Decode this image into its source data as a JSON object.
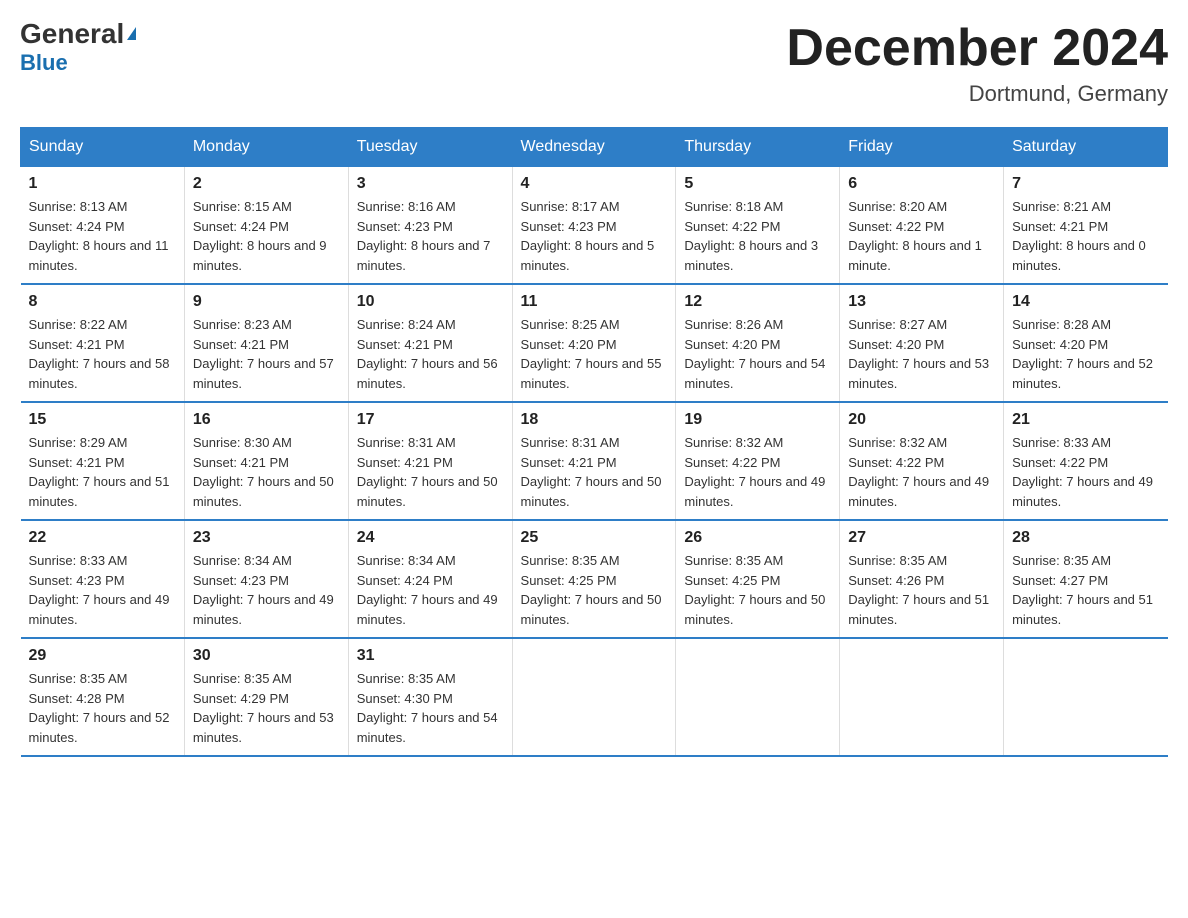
{
  "logo": {
    "part1": "General",
    "part2": "Blue"
  },
  "title": "December 2024",
  "location": "Dortmund, Germany",
  "days_header": [
    "Sunday",
    "Monday",
    "Tuesday",
    "Wednesday",
    "Thursday",
    "Friday",
    "Saturday"
  ],
  "weeks": [
    [
      {
        "num": "1",
        "sunrise": "8:13 AM",
        "sunset": "4:24 PM",
        "daylight": "8 hours and 11 minutes."
      },
      {
        "num": "2",
        "sunrise": "8:15 AM",
        "sunset": "4:24 PM",
        "daylight": "8 hours and 9 minutes."
      },
      {
        "num": "3",
        "sunrise": "8:16 AM",
        "sunset": "4:23 PM",
        "daylight": "8 hours and 7 minutes."
      },
      {
        "num": "4",
        "sunrise": "8:17 AM",
        "sunset": "4:23 PM",
        "daylight": "8 hours and 5 minutes."
      },
      {
        "num": "5",
        "sunrise": "8:18 AM",
        "sunset": "4:22 PM",
        "daylight": "8 hours and 3 minutes."
      },
      {
        "num": "6",
        "sunrise": "8:20 AM",
        "sunset": "4:22 PM",
        "daylight": "8 hours and 1 minute."
      },
      {
        "num": "7",
        "sunrise": "8:21 AM",
        "sunset": "4:21 PM",
        "daylight": "8 hours and 0 minutes."
      }
    ],
    [
      {
        "num": "8",
        "sunrise": "8:22 AM",
        "sunset": "4:21 PM",
        "daylight": "7 hours and 58 minutes."
      },
      {
        "num": "9",
        "sunrise": "8:23 AM",
        "sunset": "4:21 PM",
        "daylight": "7 hours and 57 minutes."
      },
      {
        "num": "10",
        "sunrise": "8:24 AM",
        "sunset": "4:21 PM",
        "daylight": "7 hours and 56 minutes."
      },
      {
        "num": "11",
        "sunrise": "8:25 AM",
        "sunset": "4:20 PM",
        "daylight": "7 hours and 55 minutes."
      },
      {
        "num": "12",
        "sunrise": "8:26 AM",
        "sunset": "4:20 PM",
        "daylight": "7 hours and 54 minutes."
      },
      {
        "num": "13",
        "sunrise": "8:27 AM",
        "sunset": "4:20 PM",
        "daylight": "7 hours and 53 minutes."
      },
      {
        "num": "14",
        "sunrise": "8:28 AM",
        "sunset": "4:20 PM",
        "daylight": "7 hours and 52 minutes."
      }
    ],
    [
      {
        "num": "15",
        "sunrise": "8:29 AM",
        "sunset": "4:21 PM",
        "daylight": "7 hours and 51 minutes."
      },
      {
        "num": "16",
        "sunrise": "8:30 AM",
        "sunset": "4:21 PM",
        "daylight": "7 hours and 50 minutes."
      },
      {
        "num": "17",
        "sunrise": "8:31 AM",
        "sunset": "4:21 PM",
        "daylight": "7 hours and 50 minutes."
      },
      {
        "num": "18",
        "sunrise": "8:31 AM",
        "sunset": "4:21 PM",
        "daylight": "7 hours and 50 minutes."
      },
      {
        "num": "19",
        "sunrise": "8:32 AM",
        "sunset": "4:22 PM",
        "daylight": "7 hours and 49 minutes."
      },
      {
        "num": "20",
        "sunrise": "8:32 AM",
        "sunset": "4:22 PM",
        "daylight": "7 hours and 49 minutes."
      },
      {
        "num": "21",
        "sunrise": "8:33 AM",
        "sunset": "4:22 PM",
        "daylight": "7 hours and 49 minutes."
      }
    ],
    [
      {
        "num": "22",
        "sunrise": "8:33 AM",
        "sunset": "4:23 PM",
        "daylight": "7 hours and 49 minutes."
      },
      {
        "num": "23",
        "sunrise": "8:34 AM",
        "sunset": "4:23 PM",
        "daylight": "7 hours and 49 minutes."
      },
      {
        "num": "24",
        "sunrise": "8:34 AM",
        "sunset": "4:24 PM",
        "daylight": "7 hours and 49 minutes."
      },
      {
        "num": "25",
        "sunrise": "8:35 AM",
        "sunset": "4:25 PM",
        "daylight": "7 hours and 50 minutes."
      },
      {
        "num": "26",
        "sunrise": "8:35 AM",
        "sunset": "4:25 PM",
        "daylight": "7 hours and 50 minutes."
      },
      {
        "num": "27",
        "sunrise": "8:35 AM",
        "sunset": "4:26 PM",
        "daylight": "7 hours and 51 minutes."
      },
      {
        "num": "28",
        "sunrise": "8:35 AM",
        "sunset": "4:27 PM",
        "daylight": "7 hours and 51 minutes."
      }
    ],
    [
      {
        "num": "29",
        "sunrise": "8:35 AM",
        "sunset": "4:28 PM",
        "daylight": "7 hours and 52 minutes."
      },
      {
        "num": "30",
        "sunrise": "8:35 AM",
        "sunset": "4:29 PM",
        "daylight": "7 hours and 53 minutes."
      },
      {
        "num": "31",
        "sunrise": "8:35 AM",
        "sunset": "4:30 PM",
        "daylight": "7 hours and 54 minutes."
      },
      null,
      null,
      null,
      null
    ]
  ]
}
